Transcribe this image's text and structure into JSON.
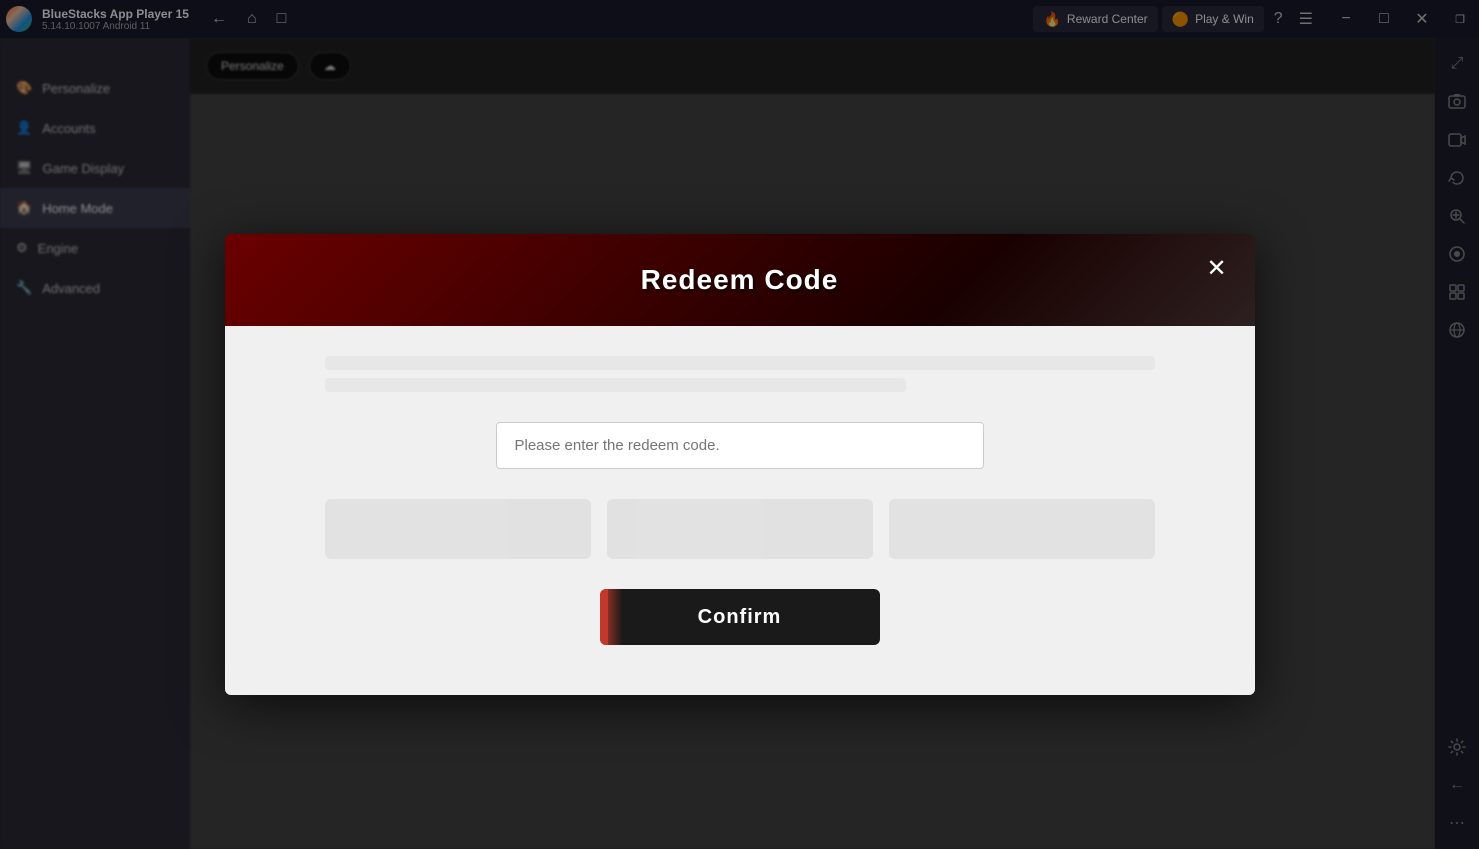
{
  "titleBar": {
    "appName": "BlueStacks App Player 15",
    "version": "5.14.10.1007  Android 11",
    "rewardCenter": "Reward Center",
    "playAndWin": "Play & Win"
  },
  "windowControls": {
    "minimize": "─",
    "maximize": "□",
    "close": "✕",
    "restore": "⧉"
  },
  "modal": {
    "title": "Redeem Code",
    "closeLabel": "✕",
    "inputPlaceholder": "Please enter the redeem code.",
    "confirmLabel": "Confirm"
  },
  "sidebar": {
    "items": [
      {
        "label": "Personalize"
      },
      {
        "label": ""
      },
      {
        "label": "Accounts"
      },
      {
        "label": "Game Display"
      },
      {
        "label": "Home Mode"
      },
      {
        "label": "Engine"
      },
      {
        "label": "Advanced"
      }
    ]
  },
  "rightSidebarIcons": [
    {
      "name": "expand-icon",
      "glyph": "⤢"
    },
    {
      "name": "screenshot-icon",
      "glyph": "📷"
    },
    {
      "name": "camera-icon",
      "glyph": "🎥"
    },
    {
      "name": "rotate-icon",
      "glyph": "↻"
    },
    {
      "name": "zoom-in-icon",
      "glyph": "🔍"
    },
    {
      "name": "record-icon",
      "glyph": "⏺"
    },
    {
      "name": "import-icon",
      "glyph": "📥"
    },
    {
      "name": "globe-icon",
      "glyph": "🌐"
    },
    {
      "name": "settings-icon",
      "glyph": "⚙"
    },
    {
      "name": "back-icon",
      "glyph": "←"
    },
    {
      "name": "home-icon",
      "glyph": "⌂"
    },
    {
      "name": "more-icon",
      "glyph": "⋯"
    }
  ]
}
